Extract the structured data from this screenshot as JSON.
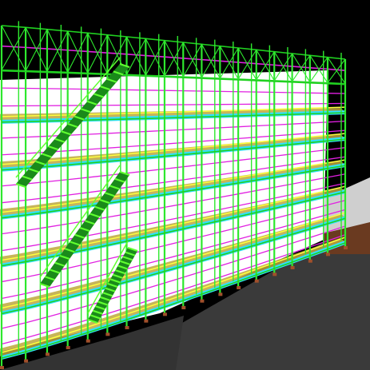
{
  "viewport": {
    "kind": "3d-scaffold-render",
    "elements": [
      "ground-plane",
      "facade-wall",
      "side-wall",
      "scaffold-uprights",
      "scaffold-ledgers",
      "scaffold-braces",
      "work-decks",
      "toe-boards",
      "stair-flights",
      "guard-rails"
    ]
  },
  "colors": {
    "background": "#000000",
    "ground": "#3a3a3a",
    "wall": "#ffffff",
    "side_wall": "#c9c9c9",
    "upright": "#2ee82e",
    "ledger": "#20d020",
    "brace": "#2ee82e",
    "deck": "#30e0ff",
    "plank": "#bda83c",
    "toe_board": "#ffff40",
    "rail": "#e020e0",
    "stair": "#60ff30",
    "stair_dark": "#1a8a1a",
    "base_block": "#a0502a"
  },
  "icons": []
}
